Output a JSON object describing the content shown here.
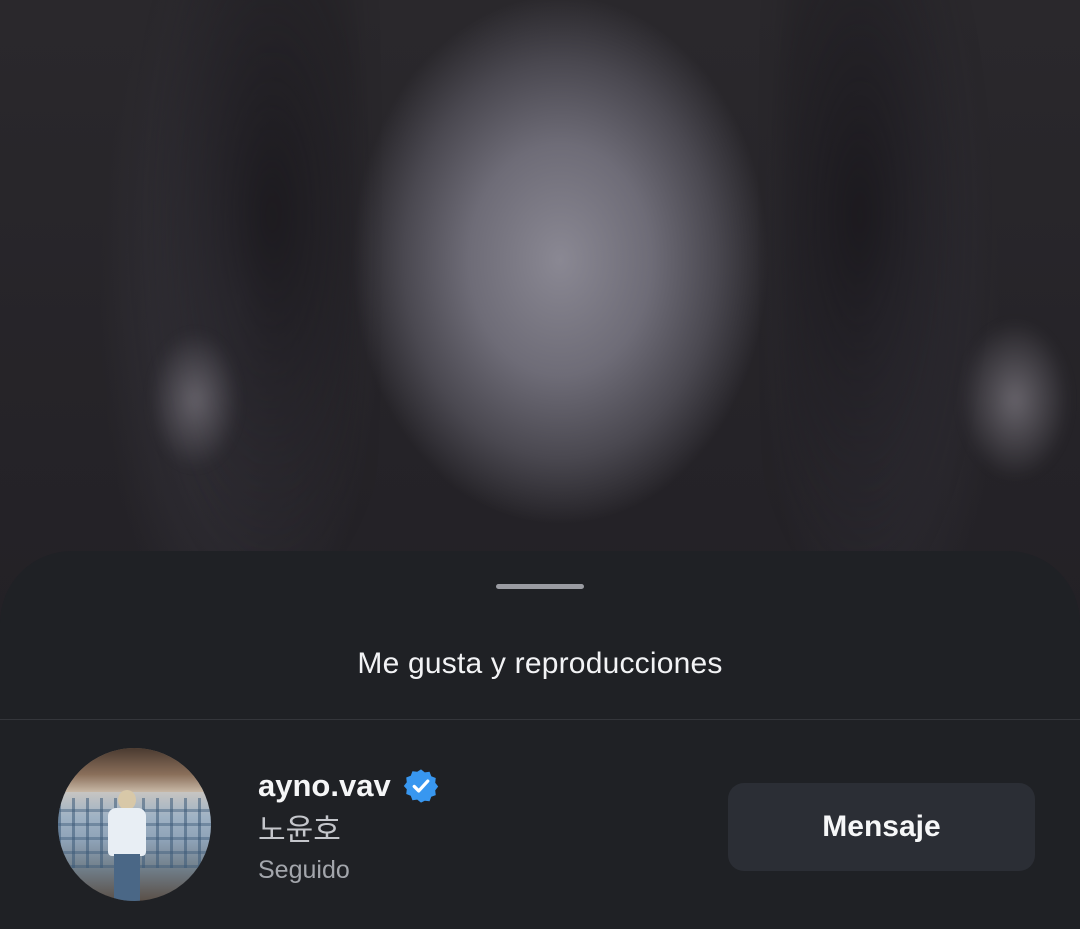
{
  "sheet": {
    "title": "Me gusta y reproducciones"
  },
  "user": {
    "username": "ayno.vav",
    "verified": true,
    "full_name": "노윤호",
    "follow_status": "Seguido",
    "message_button_label": "Mensaje"
  },
  "colors": {
    "sheet_background": "#1f2125",
    "verified_badge": "#3897f0",
    "button_background": "#2b2e35"
  },
  "icons": {
    "verified": "verified-badge-icon"
  }
}
